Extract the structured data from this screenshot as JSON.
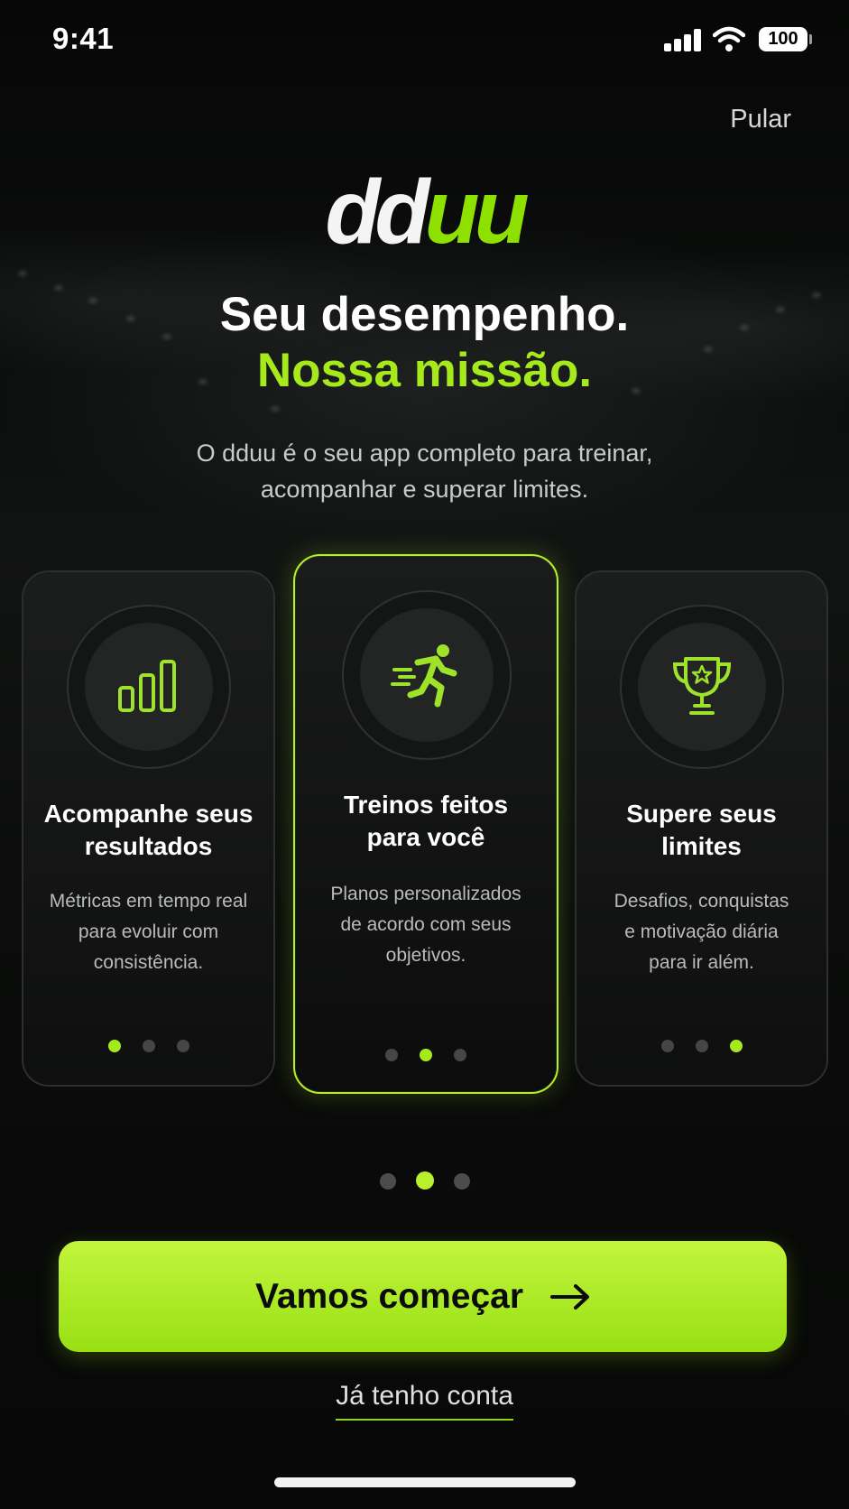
{
  "status_bar": {
    "time": "9:41",
    "battery": "100"
  },
  "header": {
    "skip_label": "Pular"
  },
  "logo": {
    "part1": "dd",
    "part2": "uu"
  },
  "hero": {
    "headline_line1": "Seu desempenho.",
    "headline_line2": "Nossa missão.",
    "subtitle_line1": "O dduu é o seu app completo para treinar,",
    "subtitle_line2": "acompanhar e superar limites."
  },
  "cards": [
    {
      "icon": "bar-chart-icon",
      "title_line1": "Acompanhe seus",
      "title_line2": "resultados",
      "desc_line1": "Métricas em tempo real",
      "desc_line2": "para evoluir com",
      "desc_line3": "consistência.",
      "active_dot": 1
    },
    {
      "icon": "running-person-icon",
      "title_line1": "Treinos feitos",
      "title_line2": "para você",
      "desc_line1": "Planos personalizados",
      "desc_line2": "de acordo com seus",
      "desc_line3": "objetivos.",
      "active_dot": 2
    },
    {
      "icon": "trophy-icon",
      "title_line1": "Supere seus",
      "title_line2": "limites",
      "desc_line1": "Desafios, conquistas",
      "desc_line2": "e motivação diária",
      "desc_line3": "para ir além.",
      "active_dot": 3
    }
  ],
  "pager": {
    "total": 3,
    "current": 2
  },
  "cta": {
    "label": "Vamos começar"
  },
  "secondary": {
    "label": "Já tenho conta"
  },
  "colors": {
    "accent": "#a6ea1c",
    "background": "#0a0b0a",
    "cta": "#b0ec2a"
  }
}
